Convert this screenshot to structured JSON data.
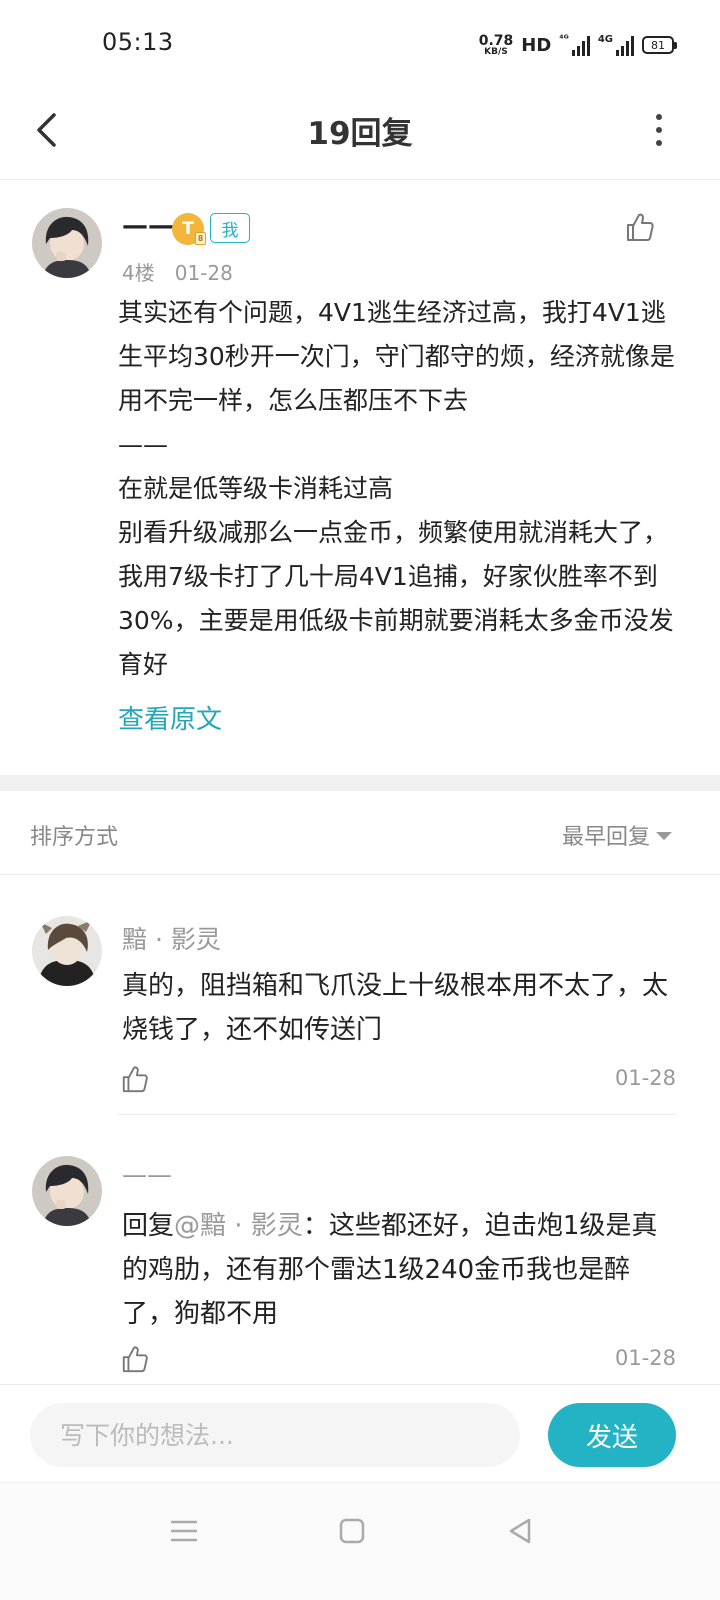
{
  "status_bar": {
    "time": "05:13",
    "net_speed_value": "0.78",
    "net_speed_unit": "KB/S",
    "hd_label": "HD",
    "signal1_label": "⁴ᴳ",
    "signal2_label": "4G",
    "battery": "81"
  },
  "header": {
    "title": "19回复",
    "back_icon": "chevron-left-icon",
    "more_icon": "more-vertical-icon"
  },
  "post": {
    "author": "——",
    "level_badge": "T",
    "level_sub": "8",
    "me_badge": "我",
    "floor": "4楼",
    "date": "01-28",
    "body_lines": [
      "其实还有个问题，4V1逃生经济过高，我打4V1逃生平均30秒开一次门，守门都守的烦，经济就像是用不完一样，怎么压都压不下去",
      "——",
      "在就是低等级卡消耗过高",
      "别看升级减那么一点金币，频繁使用就消耗大了，我用7级卡打了几十局4V1追捕，好家伙胜率不到30%，主要是用低级卡前期就要消耗太多金币没发育好"
    ],
    "view_original": "查看原文"
  },
  "sort": {
    "label": "排序方式",
    "selected": "最早回复"
  },
  "replies": [
    {
      "author": "黯 · 影灵",
      "body": "真的，阻挡箱和飞爪没上十级根本用不太了，太烧钱了，还不如传送门",
      "time": "01-28"
    },
    {
      "author": "——",
      "prefix": "回复",
      "mention": "@黯 · 影灵",
      "body": "：这些都还好，迫击炮1级是真的鸡肋，还有那个雷达1级240金币我也是醉了，狗都不用",
      "time": "01-28"
    }
  ],
  "composer": {
    "placeholder": "写下你的想法...",
    "send_label": "发送"
  },
  "colors": {
    "accent": "#24b3c4",
    "link": "#24a6b8",
    "muted": "#999999",
    "badge_gold": "#f4b63a"
  }
}
